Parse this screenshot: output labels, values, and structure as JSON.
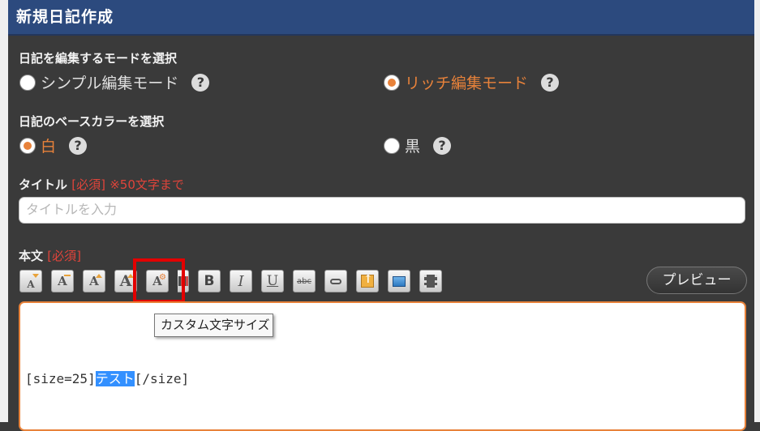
{
  "header": {
    "title": "新規日記作成"
  },
  "mode": {
    "label": "日記を編集するモードを選択",
    "options": [
      {
        "label": "シンプル編集モード",
        "selected": false
      },
      {
        "label": "リッチ編集モード",
        "selected": true
      }
    ],
    "help_glyph": "?"
  },
  "base_color": {
    "label": "日記のベースカラーを選択",
    "options": [
      {
        "label": "白",
        "selected": true
      },
      {
        "label": "黒",
        "selected": false
      }
    ]
  },
  "title_field": {
    "label": "タイトル",
    "required": "[必須]",
    "note": "※50文字まで",
    "placeholder": "タイトルを入力",
    "value": ""
  },
  "body_field": {
    "label": "本文",
    "required": "[必須]"
  },
  "toolbar": {
    "buttons": [
      {
        "icon": "font-size-down-icon"
      },
      {
        "icon": "font-size-small-icon"
      },
      {
        "icon": "font-size-up-icon"
      },
      {
        "icon": "font-size-large-icon"
      },
      {
        "icon": "custom-font-size-icon"
      },
      {
        "icon": "font-color-icon"
      },
      {
        "icon": "bold-icon"
      },
      {
        "icon": "italic-icon"
      },
      {
        "icon": "underline-icon"
      },
      {
        "icon": "strikethrough-icon"
      },
      {
        "icon": "link-icon"
      },
      {
        "icon": "upload-icon"
      },
      {
        "icon": "image-icon"
      },
      {
        "icon": "video-icon"
      }
    ],
    "preview_label": "プレビュー",
    "tooltip": "カスタム文字サイズ",
    "highlight_color": "#e30000"
  },
  "editor": {
    "prefix": "[size=25]",
    "selected": "テスト",
    "suffix": "[/size]"
  },
  "colors": {
    "header_bg": "#2c4a7e",
    "accent": "#e8823a",
    "required": "#e0443a",
    "selection": "#3390ff"
  }
}
